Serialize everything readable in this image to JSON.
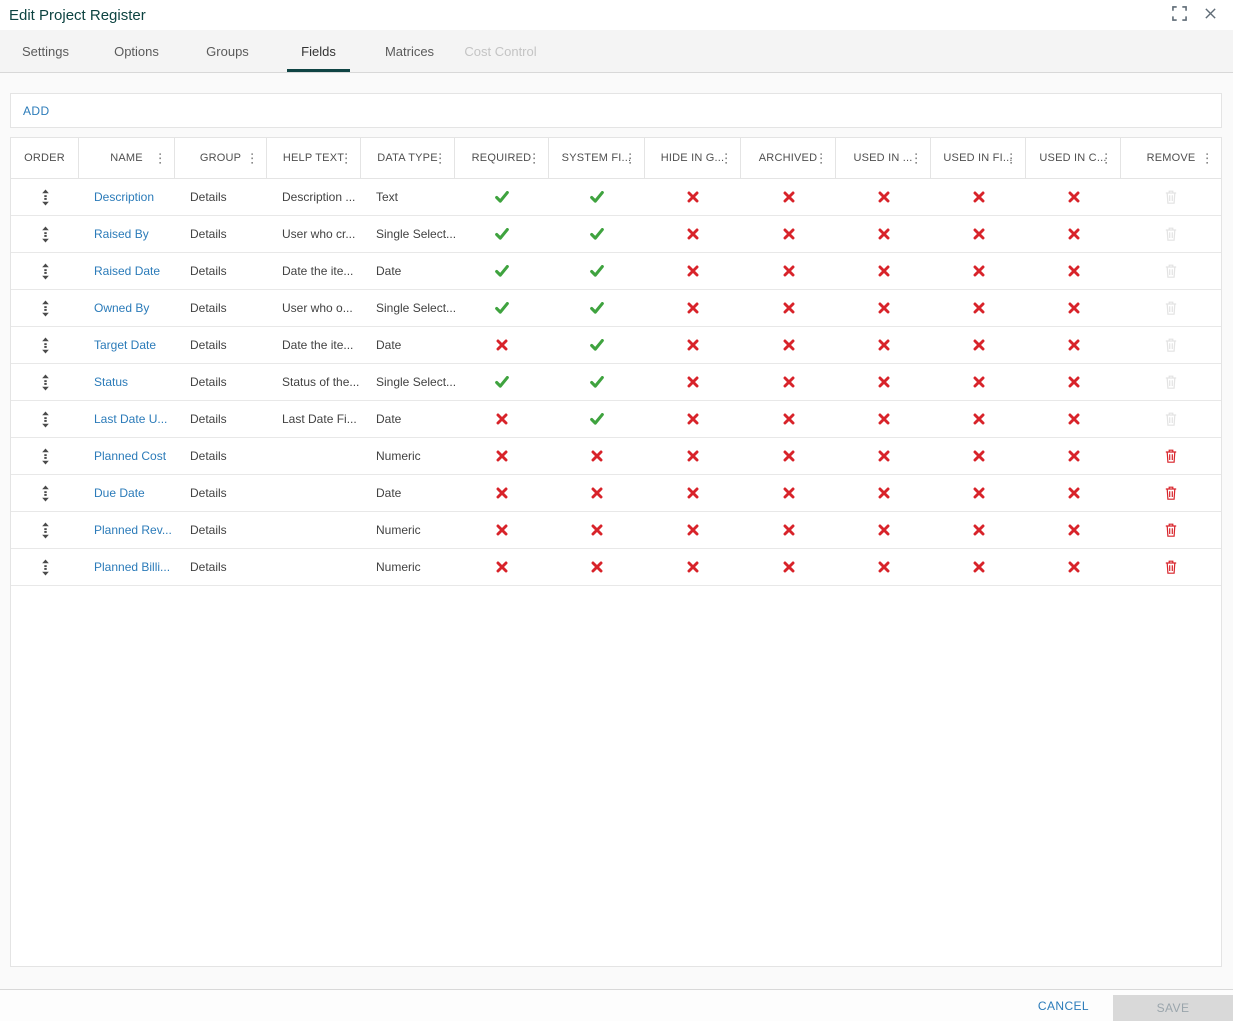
{
  "window": {
    "title": "Edit Project Register"
  },
  "tabs": [
    {
      "label": "Settings",
      "state": "normal"
    },
    {
      "label": "Options",
      "state": "normal"
    },
    {
      "label": "Groups",
      "state": "normal"
    },
    {
      "label": "Fields",
      "state": "active"
    },
    {
      "label": "Matrices",
      "state": "normal"
    },
    {
      "label": "Cost Control",
      "state": "disabled"
    }
  ],
  "toolbar": {
    "add_label": "ADD"
  },
  "grid": {
    "columns": [
      {
        "label": "ORDER",
        "menu": false
      },
      {
        "label": "NAME",
        "menu": true
      },
      {
        "label": "GROUP",
        "menu": true
      },
      {
        "label": "HELP TEXT",
        "menu": true
      },
      {
        "label": "DATA TYPE",
        "menu": true
      },
      {
        "label": "REQUIRED",
        "menu": true
      },
      {
        "label": "SYSTEM FI...",
        "menu": true
      },
      {
        "label": "HIDE IN G...",
        "menu": true
      },
      {
        "label": "ARCHIVED",
        "menu": true
      },
      {
        "label": "USED IN ...",
        "menu": true
      },
      {
        "label": "USED IN FI...",
        "menu": true
      },
      {
        "label": "USED IN C...",
        "menu": true
      },
      {
        "label": "REMOVE",
        "menu": true
      }
    ],
    "rows": [
      {
        "name": "Description",
        "group": "Details",
        "help_text": "Description ...",
        "data_type": "Text",
        "required": true,
        "system_field": true,
        "hide_in_grid": false,
        "archived": false,
        "used_in_1": false,
        "used_in_2": false,
        "used_in_3": false,
        "removable": false
      },
      {
        "name": "Raised By",
        "group": "Details",
        "help_text": "User who cr...",
        "data_type": "Single Select...",
        "required": true,
        "system_field": true,
        "hide_in_grid": false,
        "archived": false,
        "used_in_1": false,
        "used_in_2": false,
        "used_in_3": false,
        "removable": false
      },
      {
        "name": "Raised Date",
        "group": "Details",
        "help_text": "Date the ite...",
        "data_type": "Date",
        "required": true,
        "system_field": true,
        "hide_in_grid": false,
        "archived": false,
        "used_in_1": false,
        "used_in_2": false,
        "used_in_3": false,
        "removable": false
      },
      {
        "name": "Owned By",
        "group": "Details",
        "help_text": "User who o...",
        "data_type": "Single Select...",
        "required": true,
        "system_field": true,
        "hide_in_grid": false,
        "archived": false,
        "used_in_1": false,
        "used_in_2": false,
        "used_in_3": false,
        "removable": false
      },
      {
        "name": "Target Date",
        "group": "Details",
        "help_text": "Date the ite...",
        "data_type": "Date",
        "required": false,
        "system_field": true,
        "hide_in_grid": false,
        "archived": false,
        "used_in_1": false,
        "used_in_2": false,
        "used_in_3": false,
        "removable": false
      },
      {
        "name": "Status",
        "group": "Details",
        "help_text": "Status of the...",
        "data_type": "Single Select...",
        "required": true,
        "system_field": true,
        "hide_in_grid": false,
        "archived": false,
        "used_in_1": false,
        "used_in_2": false,
        "used_in_3": false,
        "removable": false
      },
      {
        "name": "Last Date U...",
        "group": "Details",
        "help_text": "Last Date Fi...",
        "data_type": "Date",
        "required": false,
        "system_field": true,
        "hide_in_grid": false,
        "archived": false,
        "used_in_1": false,
        "used_in_2": false,
        "used_in_3": false,
        "removable": false
      },
      {
        "name": "Planned Cost",
        "group": "Details",
        "help_text": "",
        "data_type": "Numeric",
        "required": false,
        "system_field": false,
        "hide_in_grid": false,
        "archived": false,
        "used_in_1": false,
        "used_in_2": false,
        "used_in_3": false,
        "removable": true
      },
      {
        "name": "Due Date",
        "group": "Details",
        "help_text": "",
        "data_type": "Date",
        "required": false,
        "system_field": false,
        "hide_in_grid": false,
        "archived": false,
        "used_in_1": false,
        "used_in_2": false,
        "used_in_3": false,
        "removable": true
      },
      {
        "name": "Planned Rev...",
        "group": "Details",
        "help_text": "",
        "data_type": "Numeric",
        "required": false,
        "system_field": false,
        "hide_in_grid": false,
        "archived": false,
        "used_in_1": false,
        "used_in_2": false,
        "used_in_3": false,
        "removable": true
      },
      {
        "name": "Planned Billi...",
        "group": "Details",
        "help_text": "",
        "data_type": "Numeric",
        "required": false,
        "system_field": false,
        "hide_in_grid": false,
        "archived": false,
        "used_in_1": false,
        "used_in_2": false,
        "used_in_3": false,
        "removable": true
      }
    ]
  },
  "footer": {
    "cancel_label": "CANCEL",
    "save_label": "SAVE",
    "save_enabled": false
  },
  "colors": {
    "accent_teal": "#0f4444",
    "title_teal": "#0d4341",
    "link_blue": "#2b7bb9",
    "check_green": "#3fa33f",
    "cross_red": "#d8232a",
    "disabled_trash": "#e3e3e3"
  }
}
